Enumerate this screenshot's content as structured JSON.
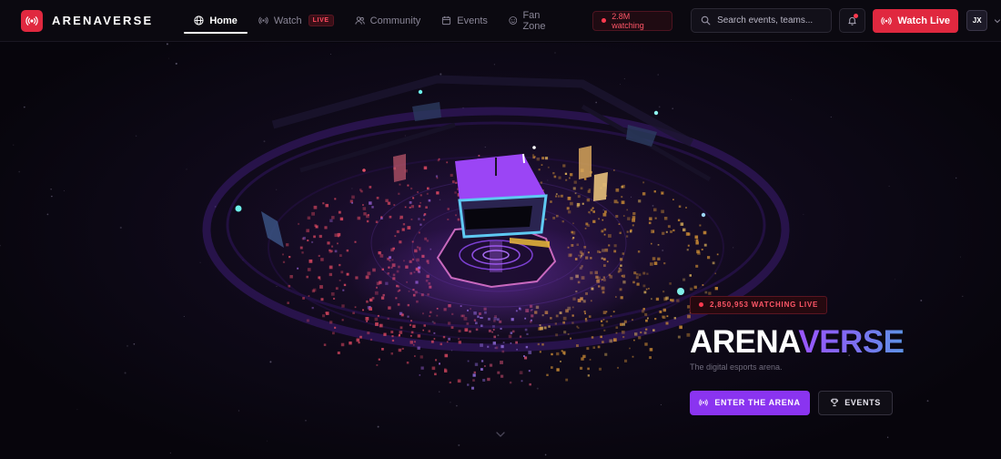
{
  "brand": {
    "name": "ARENAVERSE",
    "logo_icon": "broadcast-icon",
    "accent": "#e0283f"
  },
  "nav": {
    "links": [
      {
        "label": "Home",
        "icon": "globe-icon",
        "active": true
      },
      {
        "label": "Watch",
        "icon": "broadcast-icon",
        "badge": "LIVE"
      },
      {
        "label": "Community",
        "icon": "users-icon"
      },
      {
        "label": "Events",
        "icon": "calendar-icon"
      },
      {
        "label": "Fan Zone",
        "icon": "smile-icon"
      }
    ],
    "watching": "2.8M watching",
    "search_placeholder": "Search events, teams...",
    "watch_live_label": "Watch Live",
    "user_initials": "JX"
  },
  "hero": {
    "live_count": "2,850,953 WATCHING LIVE",
    "title_part1": "ARENA",
    "title_part2": "VERSE",
    "subtitle": "The digital esports arena.",
    "enter_label": "ENTER THE ARENA",
    "events_label": "EVENTS",
    "colors": {
      "primary": "#8a34f0",
      "live": "#ff3a4f",
      "gradient_start": "#9a55ff",
      "gradient_end": "#5d93e6"
    }
  }
}
